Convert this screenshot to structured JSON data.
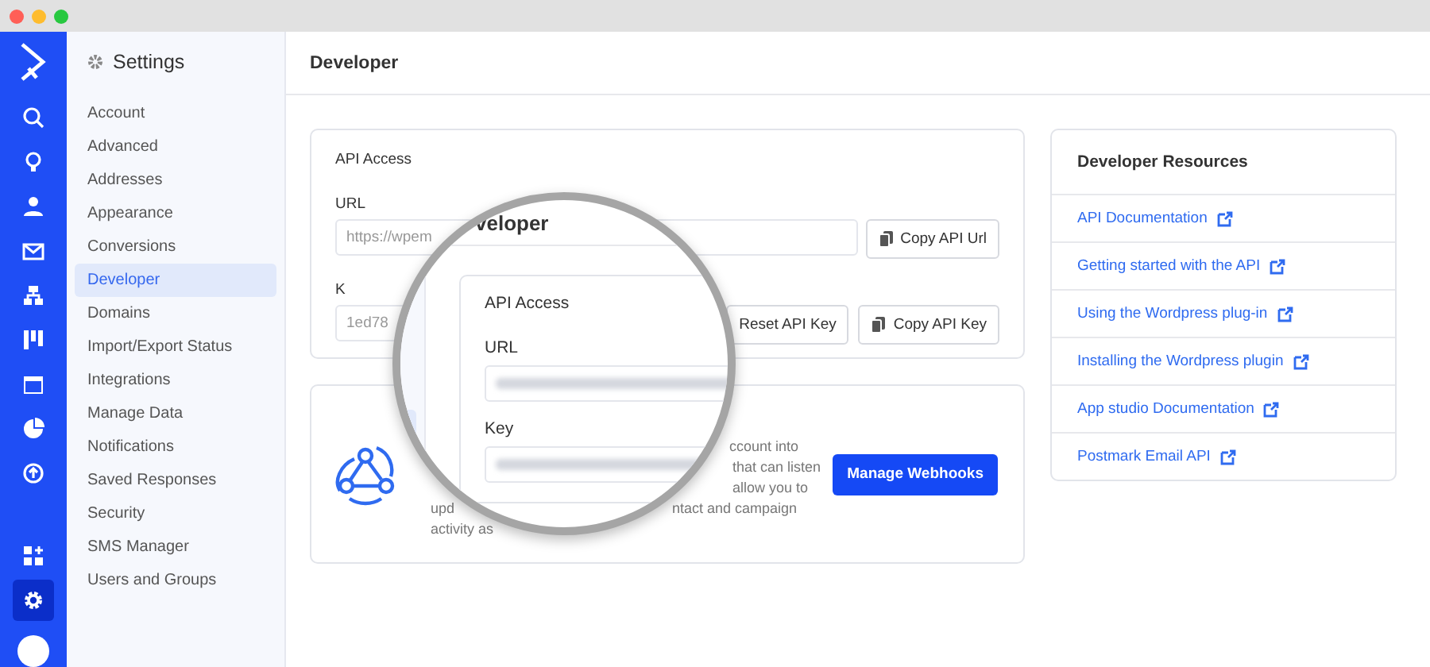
{
  "window": {
    "traffic_lights": [
      {
        "color": "#ff5f57"
      },
      {
        "color": "#febc2e"
      },
      {
        "color": "#28c840"
      }
    ]
  },
  "rail": {
    "items": [
      {
        "kind": "search",
        "selected": false
      },
      {
        "kind": "bulb",
        "selected": false
      },
      {
        "kind": "person",
        "selected": false
      },
      {
        "kind": "mail",
        "selected": false
      },
      {
        "kind": "org",
        "selected": false
      },
      {
        "kind": "board",
        "selected": false
      },
      {
        "kind": "window",
        "selected": false
      },
      {
        "kind": "pie",
        "selected": false
      },
      {
        "kind": "upload",
        "selected": false
      }
    ],
    "bottom": [
      {
        "kind": "apps",
        "selected": false
      },
      {
        "kind": "gear",
        "selected": true
      }
    ]
  },
  "settings_nav": {
    "title": "Settings",
    "items": [
      {
        "label": "Account",
        "selected": false
      },
      {
        "label": "Advanced",
        "selected": false
      },
      {
        "label": "Addresses",
        "selected": false
      },
      {
        "label": "Appearance",
        "selected": false
      },
      {
        "label": "Conversions",
        "selected": false
      },
      {
        "label": "Developer",
        "selected": true
      },
      {
        "label": "Domains",
        "selected": false
      },
      {
        "label": "Import/Export Status",
        "selected": false
      },
      {
        "label": "Integrations",
        "selected": false
      },
      {
        "label": "Manage Data",
        "selected": false
      },
      {
        "label": "Notifications",
        "selected": false
      },
      {
        "label": "Saved Responses",
        "selected": false
      },
      {
        "label": "Security",
        "selected": false
      },
      {
        "label": "SMS Manager",
        "selected": false
      },
      {
        "label": "Users and Groups",
        "selected": false
      }
    ]
  },
  "page": {
    "title": "Developer"
  },
  "api_access": {
    "title": "API Access",
    "url_label": "URL",
    "url_value": "https://wpem",
    "copy_url_button": "Copy API Url",
    "key_label": "K",
    "key_value": "1ed78",
    "reset_key_button": "Reset API Key",
    "copy_key_button": "Copy API Key"
  },
  "webhooks": {
    "description_lines": [
      {
        "right": "ccount into"
      },
      {
        "right": "that can listen"
      },
      {
        "right": "allow you to"
      },
      {
        "left": "upd",
        "right": "ntact and campaign"
      },
      {
        "left": "activity as"
      }
    ],
    "manage_button": "Manage Webhooks"
  },
  "resources": {
    "title": "Developer Resources",
    "links": [
      {
        "label": "API Documentation"
      },
      {
        "label": "Getting started with the API"
      },
      {
        "label": "Using the Wordpress plug-in"
      },
      {
        "label": "Installing the Wordpress plugin"
      },
      {
        "label": "App studio Documentation"
      },
      {
        "label": "Postmark Email API"
      }
    ]
  },
  "magnifier": {
    "page_title": "veloper",
    "card_title": "API Access",
    "url_label": "URL",
    "key_label": "Key"
  }
}
